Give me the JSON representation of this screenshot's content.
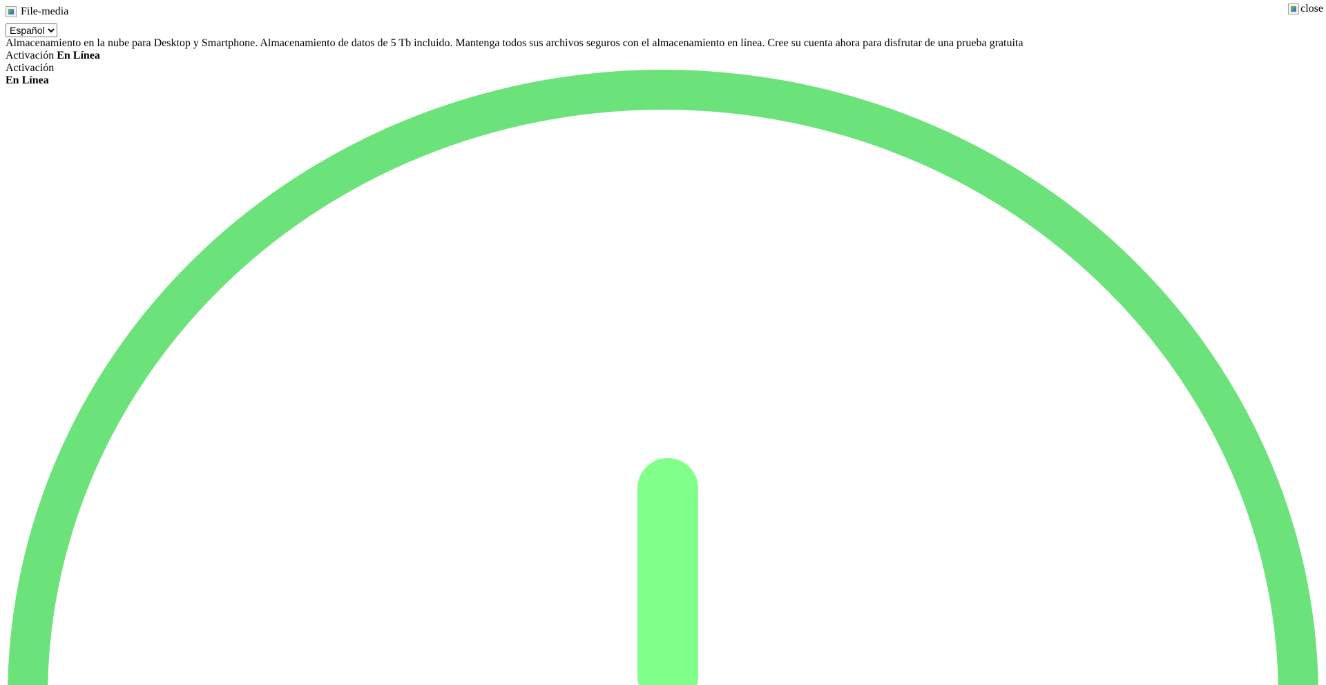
{
  "header": {
    "logo_icon": "brand-logo-broken-image",
    "brand_name": "File-media",
    "close_alt": "close",
    "close_icon": "broken-image-close-icon"
  },
  "language": {
    "selected": "Español",
    "options": [
      "Español"
    ]
  },
  "description": "Almacenamiento en la nube para Desktop y Smartphone. Almacenamiento de datos de 5 Tb incluido. Mantenga todos sus archivos seguros con el almacenamiento en línea. Cree su cuenta ahora para disfrutar de una prueba gratuita",
  "status_inline": {
    "label": "Activación",
    "value": "En Línea"
  },
  "status_stacked": {
    "label": "Activación",
    "value": "En Línea"
  },
  "power_icon": {
    "name": "power-icon",
    "ring_color": "#6ce27a",
    "bar_color": "#80ff8a"
  }
}
